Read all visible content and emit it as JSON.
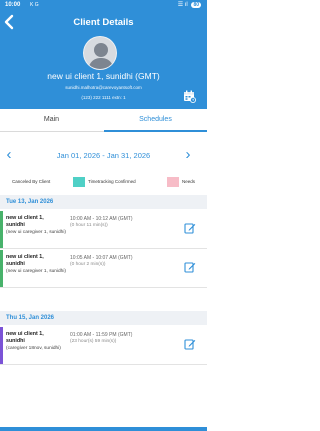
{
  "status_bar": {
    "time": "10:00",
    "icons_left": "K G",
    "signal": "☰ ıl",
    "battery": "80"
  },
  "header": {
    "title": "Client Details",
    "client_name": "new ui client 1, sunidhi (GMT)",
    "email": "sunidhi.malhotra@carevoyantsoft.com",
    "phone": "(123) 222 1111 extn: 1"
  },
  "tabs": [
    {
      "label": "Main"
    },
    {
      "label": "Schedules"
    }
  ],
  "active_tab": "Schedules",
  "date_range": {
    "label": "Jan 01, 2026 - Jan 31, 2026"
  },
  "legend": [
    {
      "label": "Canceled By Client",
      "color": ""
    },
    {
      "label": "Timetracking Confirmed",
      "color": "#4fd0c6"
    },
    {
      "label": "Needs",
      "color": "#f7bcc7"
    }
  ],
  "days": [
    {
      "date": "Tue 13, Jan 2026",
      "schedules": [
        {
          "client": "new ui client 1, sunidhi",
          "caregiver": "(new ui caregiver 1, sunidhi)",
          "time": "10:00 AM - 10:12 AM (GMT)",
          "duration": "(0 hour 11 min(s))",
          "bar_color": "#48b26b"
        },
        {
          "client": "new ui client 1, sunidhi",
          "caregiver": "(new ui caregiver 1, sunidhi)",
          "time": "10:05 AM - 10:07 AM (GMT)",
          "duration": "(0 hour 2 min(s))",
          "bar_color": "#48b26b"
        }
      ]
    },
    {
      "date": "Thu 15, Jan 2026",
      "schedules": [
        {
          "client": "new ui client 1, sunidhi",
          "caregiver": "(caregiver 18nov, sunidhi)",
          "time": "01:00 AM - 11:59 PM (GMT)",
          "duration": "(23 hour(s) 59 min(s))",
          "bar_color": "#7b53d6"
        }
      ]
    }
  ],
  "colors": {
    "primary": "#2f8fd8",
    "day_header_bg": "#eef1f5"
  }
}
